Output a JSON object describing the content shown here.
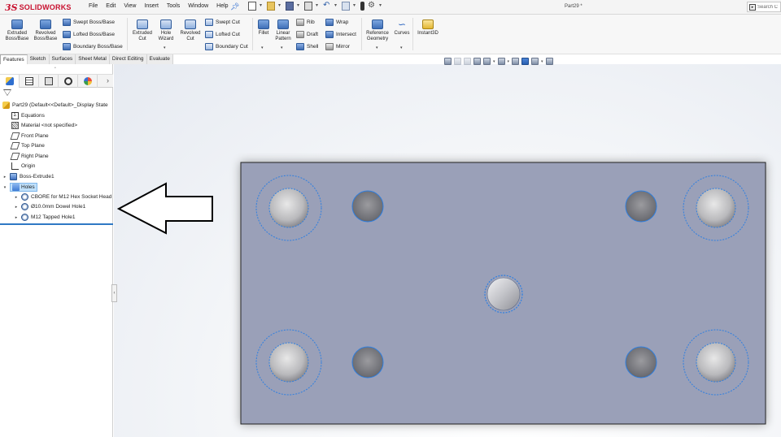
{
  "app": {
    "logo_ds": "3S",
    "logo_name": "SOLIDWORKS",
    "menu": [
      "File",
      "Edit",
      "View",
      "Insert",
      "Tools",
      "Window",
      "Help"
    ],
    "document_title": "Part29 *",
    "search_placeholder": "Search C"
  },
  "ribbon": {
    "extruded_boss": "Extruded\nBoss/Base",
    "revolved_boss": "Revolved\nBoss/Base",
    "swept_boss": "Swept Boss/Base",
    "lofted_boss": "Lofted Boss/Base",
    "boundary_boss": "Boundary Boss/Base",
    "extruded_cut": "Extruded\nCut",
    "hole_wizard": "Hole\nWizard",
    "revolved_cut": "Revolved\nCut",
    "swept_cut": "Swept Cut",
    "lofted_cut": "Lofted Cut",
    "boundary_cut": "Boundary Cut",
    "fillet": "Fillet",
    "linear_pattern": "Linear\nPattern",
    "rib": "Rib",
    "draft": "Draft",
    "shell": "Shell",
    "wrap": "Wrap",
    "intersect": "Intersect",
    "mirror": "Mirror",
    "reference_geometry": "Reference\nGeometry",
    "curves": "Curves",
    "instant3d": "Instant3D"
  },
  "tabs": [
    {
      "label": "Features",
      "active": true
    },
    {
      "label": "Sketch",
      "active": false
    },
    {
      "label": "Surfaces",
      "active": false
    },
    {
      "label": "Sheet Metal",
      "active": false
    },
    {
      "label": "Direct Editing",
      "active": false
    },
    {
      "label": "Evaluate",
      "active": false
    }
  ],
  "feature_tree": {
    "root": "Part29  (Default<<Default>_Display State",
    "items": [
      {
        "label": "Equations",
        "icon": "equations-icon"
      },
      {
        "label": "Material <not specified>",
        "icon": "material-icon"
      },
      {
        "label": "Front Plane",
        "icon": "plane-icon"
      },
      {
        "label": "Top Plane",
        "icon": "plane-icon"
      },
      {
        "label": "Right Plane",
        "icon": "plane-icon"
      },
      {
        "label": "Origin",
        "icon": "origin-icon"
      },
      {
        "label": "Boss-Extrude1",
        "icon": "extrude-icon"
      },
      {
        "label": "Holes",
        "icon": "folder-icon"
      },
      {
        "label": "CBORE for M12 Hex Socket Head",
        "icon": "hole-icon"
      },
      {
        "label": "Ø10.0mm Dowel Hole1",
        "icon": "hole-icon"
      },
      {
        "label": "M12 Tapped Hole1",
        "icon": "hole-icon"
      }
    ]
  },
  "colors": {
    "part_face": "#9aa0b8",
    "hole_highlight": "#2f7fe0",
    "selection_blue": "#bfe0fb",
    "brand_red": "#c8102e"
  }
}
